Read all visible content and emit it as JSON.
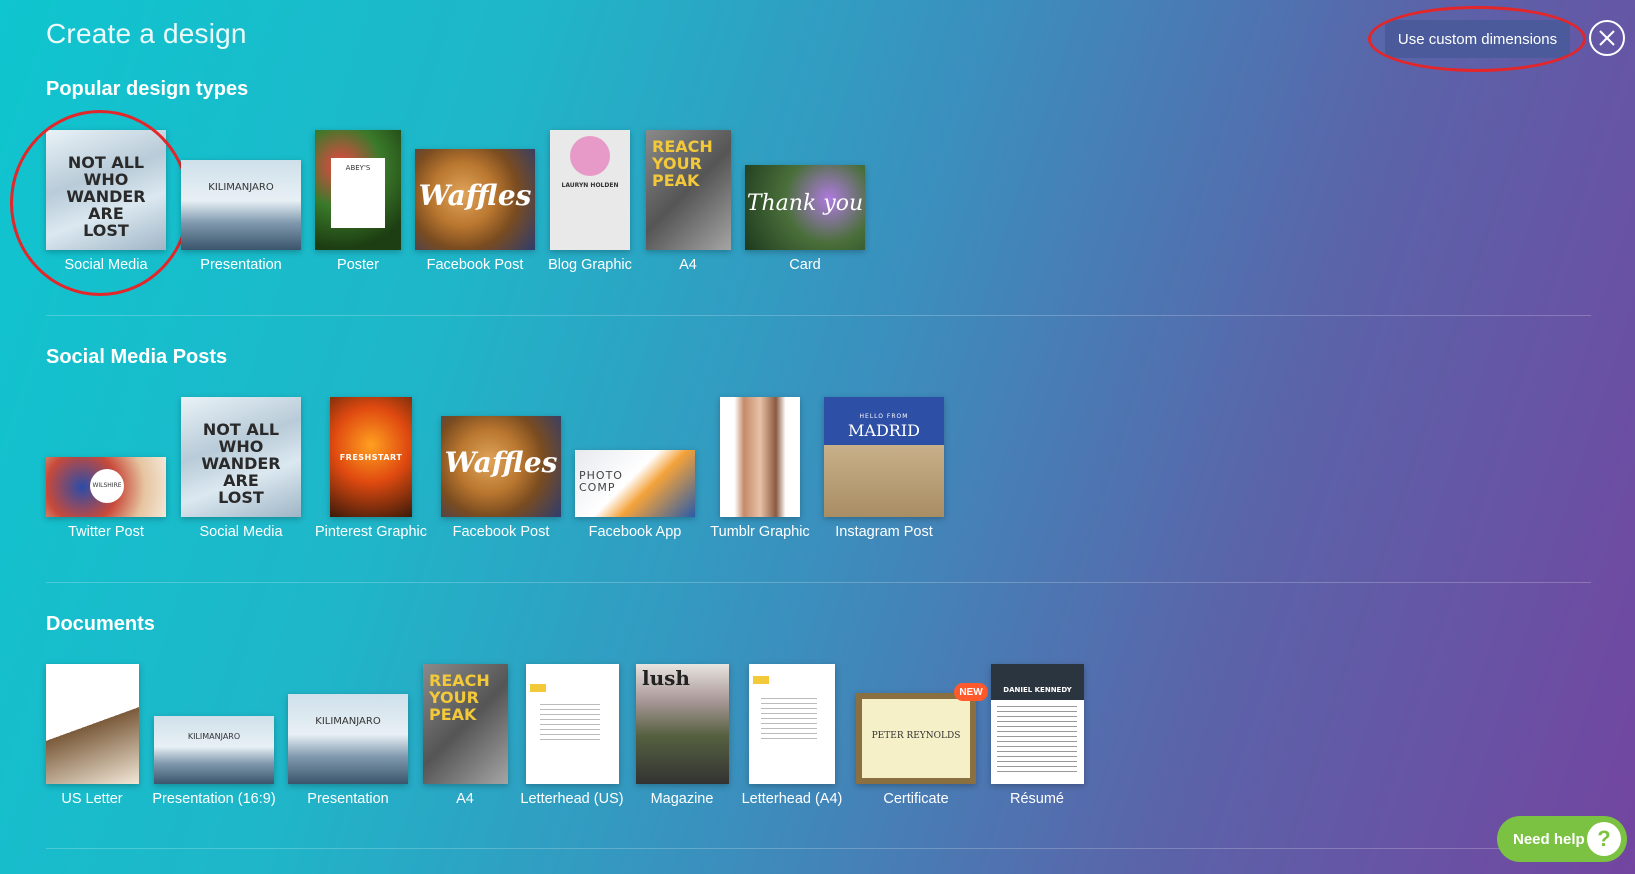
{
  "header": {
    "title": "Create a design",
    "custom_dimensions_label": "Use custom dimensions"
  },
  "sections": [
    {
      "title": "Popular design types",
      "items": [
        {
          "label": "Social Media"
        },
        {
          "label": "Presentation"
        },
        {
          "label": "Poster"
        },
        {
          "label": "Facebook Post"
        },
        {
          "label": "Blog Graphic"
        },
        {
          "label": "A4"
        },
        {
          "label": "Card"
        }
      ]
    },
    {
      "title": "Social Media Posts",
      "items": [
        {
          "label": "Twitter Post"
        },
        {
          "label": "Social Media"
        },
        {
          "label": "Pinterest Graphic"
        },
        {
          "label": "Facebook Post"
        },
        {
          "label": "Facebook App"
        },
        {
          "label": "Tumblr Graphic"
        },
        {
          "label": "Instagram Post"
        }
      ]
    },
    {
      "title": "Documents",
      "items": [
        {
          "label": "US Letter"
        },
        {
          "label": "Presentation (16:9)"
        },
        {
          "label": "Presentation"
        },
        {
          "label": "A4"
        },
        {
          "label": "Letterhead (US)"
        },
        {
          "label": "Magazine"
        },
        {
          "label": "Letterhead (A4)"
        },
        {
          "label": "Certificate",
          "badge": "NEW"
        },
        {
          "label": "Résumé"
        }
      ]
    }
  ],
  "thumb_text": {
    "not_all": "NOT ALL WHO WANDER ARE LOST",
    "kilimanjaro": "KILIMANJARO",
    "waffles": "Waffles",
    "reach": "REACH YOUR PEAK",
    "thank_you": "Thank you",
    "freshstart": "FRESHSTART",
    "photo_comp": "PHOTO COMP",
    "madrid": "MADRID",
    "hello_from": "HELLO FROM",
    "lush": "lush",
    "peter": "PETER REYNOLDS",
    "daniel": "DANIEL KENNEDY",
    "lauryn": "LAURYN HOLDEN",
    "wilshire": "WILSHIRE",
    "abeys": "ABEY'S"
  },
  "help": {
    "label": "Need help",
    "icon": "?"
  }
}
